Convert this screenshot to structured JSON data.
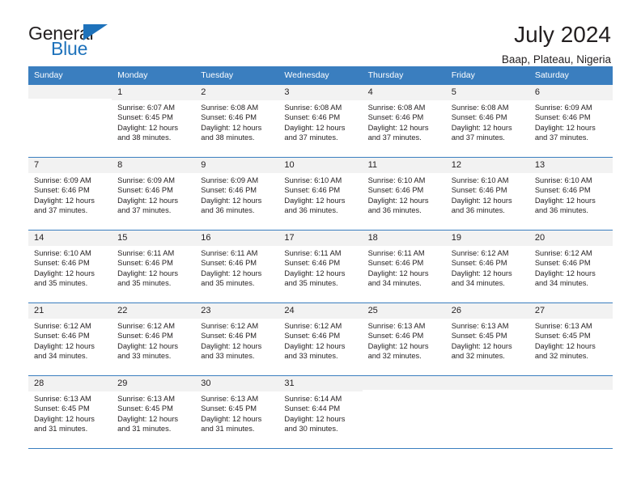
{
  "brand": {
    "name_top": "General",
    "name_bottom": "Blue",
    "triangle_color": "#1e72bb"
  },
  "header": {
    "title": "July 2024",
    "subtitle": "Baap, Plateau, Nigeria"
  },
  "theme": {
    "header_row_bg": "#3a7ebf",
    "header_row_text": "#ffffff",
    "daynum_bg": "#f2f2f2",
    "text": "#231f20"
  },
  "weekdays": [
    "Sunday",
    "Monday",
    "Tuesday",
    "Wednesday",
    "Thursday",
    "Friday",
    "Saturday"
  ],
  "weeks": [
    [
      {
        "day": "",
        "info": ""
      },
      {
        "day": "1",
        "info": "Sunrise: 6:07 AM\nSunset: 6:45 PM\nDaylight: 12 hours\nand 38 minutes."
      },
      {
        "day": "2",
        "info": "Sunrise: 6:08 AM\nSunset: 6:46 PM\nDaylight: 12 hours\nand 38 minutes."
      },
      {
        "day": "3",
        "info": "Sunrise: 6:08 AM\nSunset: 6:46 PM\nDaylight: 12 hours\nand 37 minutes."
      },
      {
        "day": "4",
        "info": "Sunrise: 6:08 AM\nSunset: 6:46 PM\nDaylight: 12 hours\nand 37 minutes."
      },
      {
        "day": "5",
        "info": "Sunrise: 6:08 AM\nSunset: 6:46 PM\nDaylight: 12 hours\nand 37 minutes."
      },
      {
        "day": "6",
        "info": "Sunrise: 6:09 AM\nSunset: 6:46 PM\nDaylight: 12 hours\nand 37 minutes."
      }
    ],
    [
      {
        "day": "7",
        "info": "Sunrise: 6:09 AM\nSunset: 6:46 PM\nDaylight: 12 hours\nand 37 minutes."
      },
      {
        "day": "8",
        "info": "Sunrise: 6:09 AM\nSunset: 6:46 PM\nDaylight: 12 hours\nand 37 minutes."
      },
      {
        "day": "9",
        "info": "Sunrise: 6:09 AM\nSunset: 6:46 PM\nDaylight: 12 hours\nand 36 minutes."
      },
      {
        "day": "10",
        "info": "Sunrise: 6:10 AM\nSunset: 6:46 PM\nDaylight: 12 hours\nand 36 minutes."
      },
      {
        "day": "11",
        "info": "Sunrise: 6:10 AM\nSunset: 6:46 PM\nDaylight: 12 hours\nand 36 minutes."
      },
      {
        "day": "12",
        "info": "Sunrise: 6:10 AM\nSunset: 6:46 PM\nDaylight: 12 hours\nand 36 minutes."
      },
      {
        "day": "13",
        "info": "Sunrise: 6:10 AM\nSunset: 6:46 PM\nDaylight: 12 hours\nand 36 minutes."
      }
    ],
    [
      {
        "day": "14",
        "info": "Sunrise: 6:10 AM\nSunset: 6:46 PM\nDaylight: 12 hours\nand 35 minutes."
      },
      {
        "day": "15",
        "info": "Sunrise: 6:11 AM\nSunset: 6:46 PM\nDaylight: 12 hours\nand 35 minutes."
      },
      {
        "day": "16",
        "info": "Sunrise: 6:11 AM\nSunset: 6:46 PM\nDaylight: 12 hours\nand 35 minutes."
      },
      {
        "day": "17",
        "info": "Sunrise: 6:11 AM\nSunset: 6:46 PM\nDaylight: 12 hours\nand 35 minutes."
      },
      {
        "day": "18",
        "info": "Sunrise: 6:11 AM\nSunset: 6:46 PM\nDaylight: 12 hours\nand 34 minutes."
      },
      {
        "day": "19",
        "info": "Sunrise: 6:12 AM\nSunset: 6:46 PM\nDaylight: 12 hours\nand 34 minutes."
      },
      {
        "day": "20",
        "info": "Sunrise: 6:12 AM\nSunset: 6:46 PM\nDaylight: 12 hours\nand 34 minutes."
      }
    ],
    [
      {
        "day": "21",
        "info": "Sunrise: 6:12 AM\nSunset: 6:46 PM\nDaylight: 12 hours\nand 34 minutes."
      },
      {
        "day": "22",
        "info": "Sunrise: 6:12 AM\nSunset: 6:46 PM\nDaylight: 12 hours\nand 33 minutes."
      },
      {
        "day": "23",
        "info": "Sunrise: 6:12 AM\nSunset: 6:46 PM\nDaylight: 12 hours\nand 33 minutes."
      },
      {
        "day": "24",
        "info": "Sunrise: 6:12 AM\nSunset: 6:46 PM\nDaylight: 12 hours\nand 33 minutes."
      },
      {
        "day": "25",
        "info": "Sunrise: 6:13 AM\nSunset: 6:46 PM\nDaylight: 12 hours\nand 32 minutes."
      },
      {
        "day": "26",
        "info": "Sunrise: 6:13 AM\nSunset: 6:45 PM\nDaylight: 12 hours\nand 32 minutes."
      },
      {
        "day": "27",
        "info": "Sunrise: 6:13 AM\nSunset: 6:45 PM\nDaylight: 12 hours\nand 32 minutes."
      }
    ],
    [
      {
        "day": "28",
        "info": "Sunrise: 6:13 AM\nSunset: 6:45 PM\nDaylight: 12 hours\nand 31 minutes."
      },
      {
        "day": "29",
        "info": "Sunrise: 6:13 AM\nSunset: 6:45 PM\nDaylight: 12 hours\nand 31 minutes."
      },
      {
        "day": "30",
        "info": "Sunrise: 6:13 AM\nSunset: 6:45 PM\nDaylight: 12 hours\nand 31 minutes."
      },
      {
        "day": "31",
        "info": "Sunrise: 6:14 AM\nSunset: 6:44 PM\nDaylight: 12 hours\nand 30 minutes."
      },
      {
        "day": "",
        "info": ""
      },
      {
        "day": "",
        "info": ""
      },
      {
        "day": "",
        "info": ""
      }
    ]
  ]
}
